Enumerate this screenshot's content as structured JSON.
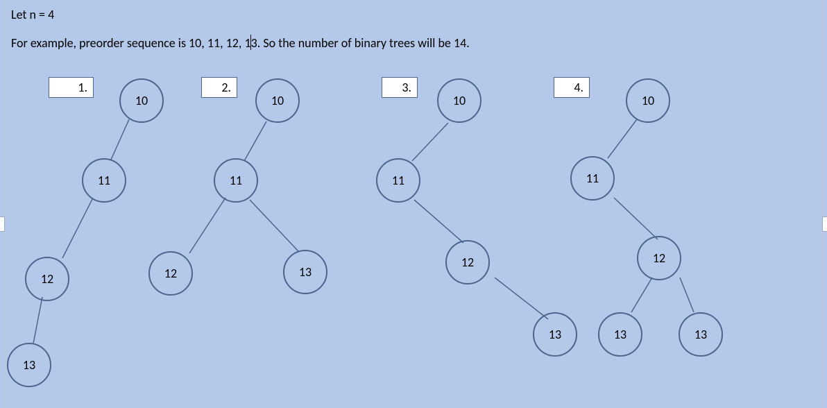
{
  "text": {
    "line1": "Let n = 4",
    "line2_a": "For example, preorder sequence is 10, 11, 12, 1",
    "line2_b": "3. So the number of binary trees will be 14."
  },
  "labels": {
    "l1": "1.",
    "l2": "2.",
    "l3": "3.",
    "l4": "4."
  },
  "nodes": {
    "t1": {
      "a": "10",
      "b": "11",
      "c": "12",
      "d": "13"
    },
    "t2": {
      "a": "10",
      "b": "11",
      "c": "12",
      "d": "13"
    },
    "t3": {
      "a": "10",
      "b": "11",
      "c": "12",
      "d": "13"
    },
    "t4": {
      "a": "10",
      "b": "11",
      "c": "12",
      "d": "13",
      "e": "13"
    }
  },
  "chart_data": {
    "type": "diagram",
    "title": "Binary trees with preorder sequence 10,11,12,13 (n=4, 14 total)",
    "n": 4,
    "preorder_sequence": [
      10,
      11,
      12,
      13
    ],
    "total_trees": 14,
    "trees_shown": [
      {
        "index": 1,
        "nodes": [
          {
            "id": "10",
            "left": "11",
            "right": null
          },
          {
            "id": "11",
            "left": "12",
            "right": null
          },
          {
            "id": "12",
            "left": "13",
            "right": null
          },
          {
            "id": "13",
            "left": null,
            "right": null
          }
        ]
      },
      {
        "index": 2,
        "nodes": [
          {
            "id": "10",
            "left": "11",
            "right": null
          },
          {
            "id": "11",
            "left": "12",
            "right": "13"
          },
          {
            "id": "12",
            "left": null,
            "right": null
          },
          {
            "id": "13",
            "left": null,
            "right": null
          }
        ]
      },
      {
        "index": 3,
        "nodes": [
          {
            "id": "10",
            "left": "11",
            "right": null
          },
          {
            "id": "11",
            "left": null,
            "right": "12"
          },
          {
            "id": "12",
            "left": null,
            "right": "13"
          },
          {
            "id": "13",
            "left": null,
            "right": null
          }
        ]
      },
      {
        "index": 4,
        "nodes": [
          {
            "id": "10",
            "left": "11",
            "right": null
          },
          {
            "id": "11",
            "left": null,
            "right": "12"
          },
          {
            "id": "12",
            "left": "13",
            "right": "13"
          },
          {
            "id": "13",
            "left": null,
            "right": null
          }
        ]
      }
    ]
  }
}
